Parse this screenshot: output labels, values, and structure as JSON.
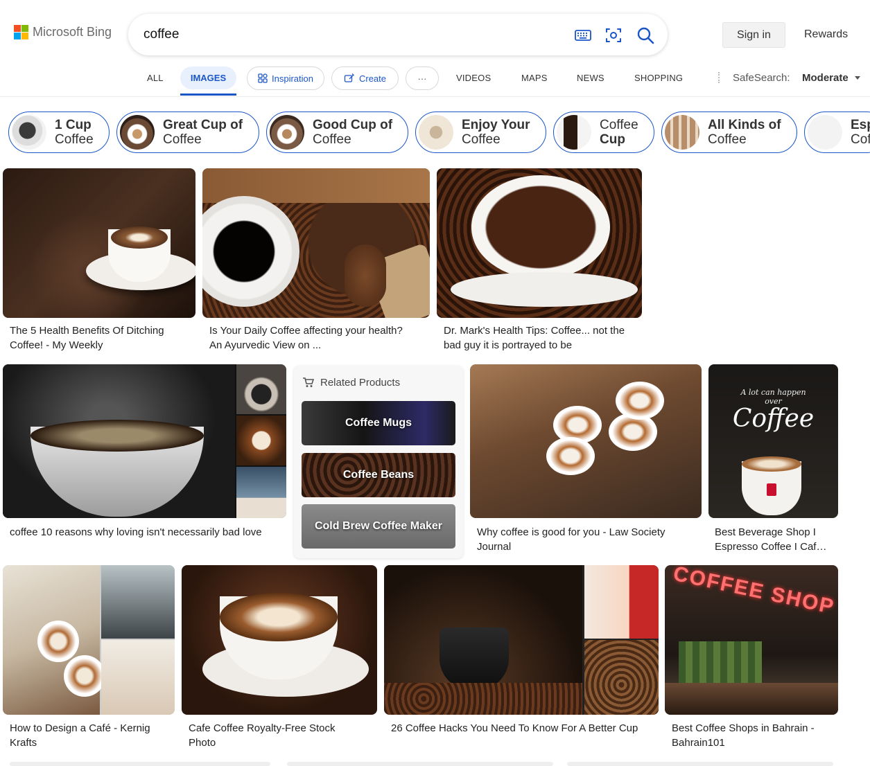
{
  "header": {
    "brand": "Microsoft Bing",
    "query": "coffee",
    "sign_in": "Sign in",
    "rewards": "Rewards",
    "icons": [
      "keyboard-icon",
      "visual-search-icon",
      "search-icon"
    ]
  },
  "nav": {
    "all": "ALL",
    "images": "IMAGES",
    "inspiration": "Inspiration",
    "create": "Create",
    "more": "···",
    "videos": "VIDEOS",
    "maps": "MAPS",
    "news": "NEWS",
    "shopping": "SHOPPING",
    "safesearch_label": "SafeSearch:",
    "safesearch_value": "Moderate"
  },
  "chips": [
    {
      "line1": "1 Cup",
      "line2": "Coffee"
    },
    {
      "line1": "Great Cup of",
      "line2": "Coffee"
    },
    {
      "line1": "Good Cup of",
      "line2": "Coffee"
    },
    {
      "line1": "Enjoy Your",
      "line2": "Coffee"
    },
    {
      "line1": "Coffee",
      "line2": "Cup"
    },
    {
      "line1": "All Kinds of",
      "line2": "Coffee"
    },
    {
      "line1": "Esp",
      "line2": "Cof"
    }
  ],
  "results": [
    {
      "caption_1": "The 5 Health Benefits Of Ditching",
      "caption_2": "Coffee! - My Weekly"
    },
    {
      "caption_1": "Is Your Daily Coffee affecting your health?",
      "caption_2": "An Ayurvedic View on ..."
    },
    {
      "caption_1": "Dr. Mark's Health Tips: Coffee... not the",
      "caption_2": "bad guy it is portrayed to be"
    },
    {
      "caption_1": "coffee 10 reasons why loving isn't necessarily bad love",
      "caption_2": ""
    },
    {
      "caption_1": "Why coffee is good for you - Law Society",
      "caption_2": "Journal"
    },
    {
      "caption_1": "Best Beverage Shop I",
      "caption_2": "Espresso Coffee I Caf…"
    },
    {
      "caption_1": "How to Design a Café - Kernig",
      "caption_2": "Krafts"
    },
    {
      "caption_1": "Cafe Coffee Royalty-Free Stock",
      "caption_2": "Photo"
    },
    {
      "caption_1": "26 Coffee Hacks You Need To Know For A Better Cup",
      "caption_2": ""
    },
    {
      "caption_1": "Best Coffee Shops in Bahrain -",
      "caption_2": "Bahrain101"
    }
  ],
  "related_products": {
    "title": "Related Products",
    "items": [
      "Coffee Mugs",
      "Coffee Beans",
      "Cold Brew Coffee Maker"
    ]
  },
  "image_text": {
    "coffee_poster_1": "A lot can happen",
    "coffee_poster_2": "over",
    "coffee_poster_3": "Coffee",
    "shop_sign": "COFFEE SHOP"
  },
  "colors": {
    "accent": "#1a56c7",
    "ms_red": "#f25022",
    "ms_green": "#7fba00",
    "ms_blue": "#00a4ef",
    "ms_yellow": "#ffb900"
  }
}
